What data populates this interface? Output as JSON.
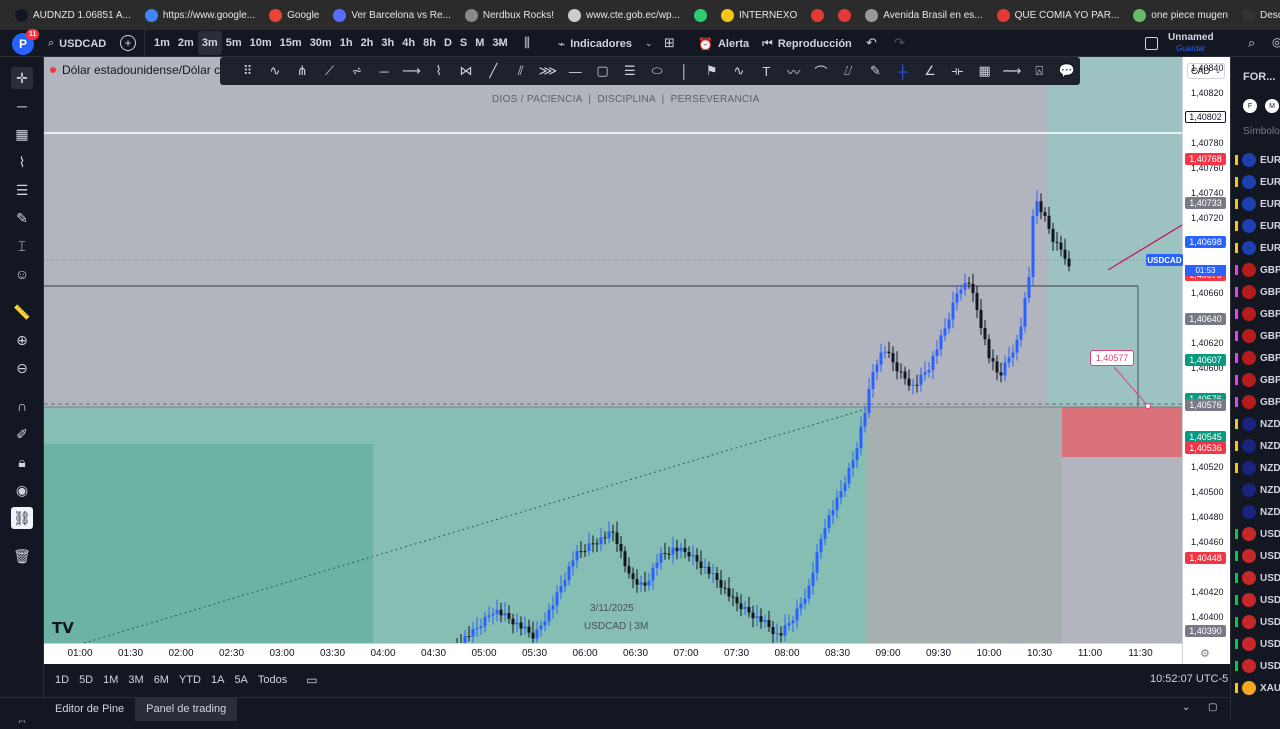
{
  "bookmarks": [
    {
      "label": "AUDNZD 1.06851 A...",
      "color": "#131722"
    },
    {
      "label": "https://www.google...",
      "color": "#4285f4"
    },
    {
      "label": "Google",
      "color": "#ea4335"
    },
    {
      "label": "Ver Barcelona vs Re...",
      "color": "#5a6cff"
    },
    {
      "label": "Nerdbux Rocks!",
      "color": "#888888"
    },
    {
      "label": "www.cte.gob.ec/wp...",
      "color": "#cccccc"
    },
    {
      "label": "",
      "color": "#2ecc71"
    },
    {
      "label": "INTERNEXO",
      "color": "#f5c518"
    },
    {
      "label": "",
      "color": "#e53935"
    },
    {
      "label": "",
      "color": "#e53935"
    },
    {
      "label": "Avenida Brasil en es...",
      "color": "#999999"
    },
    {
      "label": "QUE COMIA YO PAR...",
      "color": "#e53935"
    },
    {
      "label": "one piece mugen",
      "color": "#66bb6a"
    },
    {
      "label": "Descargar Musica d...",
      "color": "#333333"
    }
  ],
  "topbar": {
    "logo_badge": "11",
    "symbol": "USDCAD",
    "intervals": [
      "1m",
      "2m",
      "3m",
      "5m",
      "10m",
      "15m",
      "30m",
      "1h",
      "2h",
      "3h",
      "4h",
      "8h",
      "D",
      "S",
      "M",
      "3M"
    ],
    "active_interval": "3m",
    "indicators_label": "Indicadores",
    "alert_label": "Alerta",
    "replay_label": "Reproducción",
    "layout_name": "Unnamed",
    "save_label": "Guardar"
  },
  "chart": {
    "title": "Dólar estadounidense/Dólar c",
    "watermark_text": "DIOS / PACIENCIA  |  DISCIPLINA  |  PERSEVERANCIA",
    "date_label": "3/11/2025",
    "symbol_label": "USDCAD | 3M",
    "currency": "CAD",
    "symbol_tag": "USDCAD",
    "countdown": "01:53",
    "annotation_price": "1,40577"
  },
  "price_scale": {
    "ticks": [
      "1,40840",
      "1,40820",
      "1,40780",
      "1,40760",
      "1,40740",
      "1,40720",
      "1,40660",
      "1,40620",
      "1,40600",
      "1,40520",
      "1,40500",
      "1,40480",
      "1,40460",
      "1,40420",
      "1,40400"
    ],
    "tags": [
      {
        "value": "1,40802",
        "color": "#ffffff",
        "text": "#131722"
      },
      {
        "value": "1,40768",
        "color": "#f23645",
        "text": "#ffffff"
      },
      {
        "value": "1,40733",
        "color": "#787b86",
        "text": "#ffffff"
      },
      {
        "value": "1,40698",
        "color": "#2962ff",
        "text": "#ffffff"
      },
      {
        "value": "1,40675",
        "color": "#f23645",
        "text": "#ffffff"
      },
      {
        "value": "1,40640",
        "color": "#787b86",
        "text": "#ffffff"
      },
      {
        "value": "1,40607",
        "color": "#089981",
        "text": "#ffffff"
      },
      {
        "value": "1,40576",
        "color": "#089981",
        "text": "#ffffff"
      },
      {
        "value": "1,40576",
        "color": "#787b86",
        "text": "#ffffff"
      },
      {
        "value": "1,40545",
        "color": "#089981",
        "text": "#ffffff"
      },
      {
        "value": "1,40536",
        "color": "#f23645",
        "text": "#ffffff"
      },
      {
        "value": "1,40448",
        "color": "#f23645",
        "text": "#ffffff"
      },
      {
        "value": "1,40390",
        "color": "#787b86",
        "text": "#ffffff"
      }
    ]
  },
  "time_scale": {
    "labels": [
      "01:00",
      "01:30",
      "02:00",
      "02:30",
      "03:00",
      "03:30",
      "04:00",
      "04:30",
      "05:00",
      "05:30",
      "06:00",
      "06:30",
      "07:00",
      "07:30",
      "08:00",
      "08:30",
      "09:00",
      "09:30",
      "10:00",
      "10:30",
      "11:00",
      "11:30"
    ]
  },
  "bottom": {
    "ranges": [
      "1D",
      "5D",
      "1M",
      "3M",
      "6M",
      "YTD",
      "1A",
      "5A",
      "Todos"
    ],
    "clock": "10:52:07 UTC-5"
  },
  "panels": {
    "pine_editor": "Editor de Pine",
    "trading_panel": "Panel de trading"
  },
  "watchlist": {
    "header": "FOR...",
    "col_label": "Símbolo",
    "items": [
      {
        "symbol": "EUR",
        "mark": "#f5c518",
        "flag": "#1e40af"
      },
      {
        "symbol": "EUR",
        "mark": "#f5c518",
        "flag": "#1e40af"
      },
      {
        "symbol": "EUR",
        "mark": "#f5c518",
        "flag": "#1e40af"
      },
      {
        "symbol": "EUR",
        "mark": "#f5c518",
        "flag": "#1e40af"
      },
      {
        "symbol": "EUR",
        "mark": "#f5c518",
        "flag": "#1e40af"
      },
      {
        "symbol": "GBP",
        "mark": "#e040fb",
        "flag": "#b71c1c"
      },
      {
        "symbol": "GBP",
        "mark": "#e040fb",
        "flag": "#b71c1c"
      },
      {
        "symbol": "GBP",
        "mark": "#e040fb",
        "flag": "#b71c1c"
      },
      {
        "symbol": "GBP",
        "mark": "#e040fb",
        "flag": "#b71c1c"
      },
      {
        "symbol": "GBP",
        "mark": "#e040fb",
        "flag": "#b71c1c"
      },
      {
        "symbol": "GBP",
        "mark": "#e040fb",
        "flag": "#b71c1c"
      },
      {
        "symbol": "GBP",
        "mark": "#e040fb",
        "flag": "#b71c1c"
      },
      {
        "symbol": "NZD",
        "mark": "#f5c518",
        "flag": "#1a237e"
      },
      {
        "symbol": "NZD",
        "mark": "#f5c518",
        "flag": "#1a237e"
      },
      {
        "symbol": "NZD",
        "mark": "#f5c518",
        "flag": "#1a237e"
      },
      {
        "symbol": "NZD",
        "mark": "#131722",
        "flag": "#1a237e"
      },
      {
        "symbol": "NZD",
        "mark": "#131722",
        "flag": "#1a237e"
      },
      {
        "symbol": "USD",
        "mark": "#00c853",
        "flag": "#c62828"
      },
      {
        "symbol": "USD",
        "mark": "#00c853",
        "flag": "#c62828"
      },
      {
        "symbol": "USD",
        "mark": "#00c853",
        "flag": "#c62828"
      },
      {
        "symbol": "USD",
        "mark": "#00c853",
        "flag": "#c62828"
      },
      {
        "symbol": "USD",
        "mark": "#00c853",
        "flag": "#c62828"
      },
      {
        "symbol": "USD",
        "mark": "#00c853",
        "flag": "#c62828"
      },
      {
        "symbol": "USD",
        "mark": "#00c853",
        "flag": "#c62828"
      },
      {
        "symbol": "XAU",
        "mark": "#f5c518",
        "flag": "#f5a623"
      }
    ]
  }
}
